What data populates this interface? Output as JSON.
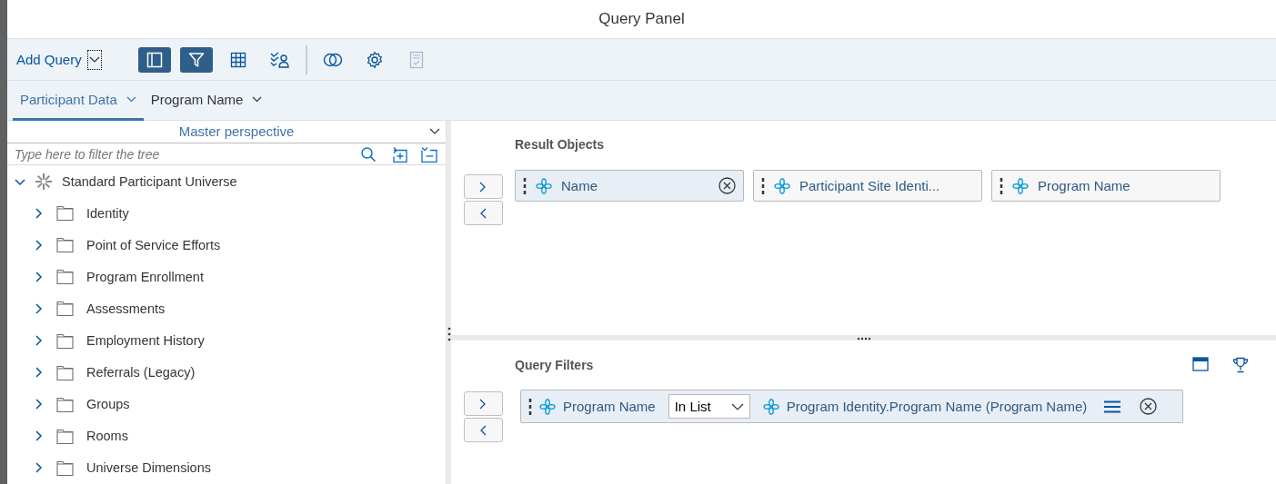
{
  "window": {
    "title": "Query Panel"
  },
  "toolbar": {
    "add_query": "Add Query",
    "buttons": [
      {
        "kind": "outline",
        "selected": true,
        "disabled": false
      },
      {
        "kind": "filter",
        "selected": true,
        "disabled": false
      },
      {
        "kind": "table",
        "selected": false,
        "disabled": false
      },
      {
        "kind": "combined",
        "selected": false,
        "disabled": false
      },
      {
        "kind": "join",
        "selected": false,
        "disabled": false
      },
      {
        "kind": "settings",
        "selected": false,
        "disabled": false
      },
      {
        "kind": "validate",
        "selected": false,
        "disabled": true
      }
    ]
  },
  "tabs": [
    {
      "label": "Participant Data",
      "selected": true
    },
    {
      "label": "Program Name",
      "selected": false
    }
  ],
  "perspective": "Master perspective",
  "search": {
    "placeholder": "Type here to filter the tree"
  },
  "tree": [
    {
      "label": "Standard Participant Universe",
      "expanded": true,
      "children": [
        {
          "label": "Identity",
          "expanded": false
        },
        {
          "label": "Point of Service Efforts",
          "expanded": false
        },
        {
          "label": "Program Enrollment",
          "expanded": false
        },
        {
          "label": "Assessments",
          "expanded": false
        },
        {
          "label": "Employment History",
          "expanded": false
        },
        {
          "label": "Referrals (Legacy)",
          "expanded": false
        },
        {
          "label": "Groups",
          "expanded": false
        },
        {
          "label": "Rooms",
          "expanded": false
        },
        {
          "label": "Universe Dimensions",
          "expanded": false
        }
      ]
    }
  ],
  "result_objects": {
    "title": "Result Objects",
    "items": [
      {
        "label": "Name",
        "selected": true
      },
      {
        "label": "Participant Site Identi...",
        "selected": false
      },
      {
        "label": "Program Name",
        "selected": false
      }
    ]
  },
  "query_filters": {
    "title": "Query Filters",
    "filters": [
      {
        "object": "Program Name",
        "operator": "In List",
        "value": "Program Identity.Program Name (Program Name)"
      }
    ]
  }
}
